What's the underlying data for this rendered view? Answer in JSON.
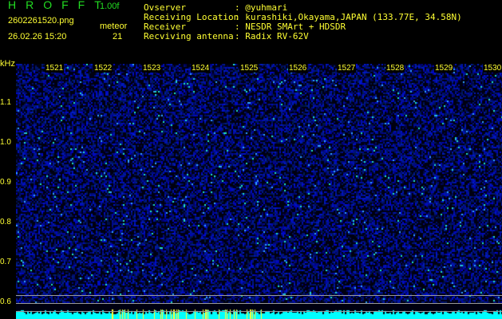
{
  "header": {
    "brand": "HROFFT",
    "version": "1.00f",
    "filename": "2602261520.png",
    "datetime": "26.02.26 15:20",
    "count_label": "meteor",
    "count": "21"
  },
  "info": [
    {
      "label": "Ovserver",
      "value": ": @yuhmari"
    },
    {
      "label": "Receiving Location",
      "value": ": kurashiki,Okayama,JAPAN (133.77E, 34.58N)"
    },
    {
      "label": "Receiver",
      "value": ": NESDR SMArt + HDSDR"
    },
    {
      "label": "Recviving antenna",
      "value": ": Radix RV-62V"
    }
  ],
  "axis": {
    "unit": "kHz",
    "x_ticks": [
      "1521",
      "1522",
      "1523",
      "1524",
      "1525",
      "1526",
      "1527",
      "1528",
      "1529",
      "1530"
    ],
    "y_ticks": [
      "1.1",
      "1.0",
      "0.9",
      "0.8",
      "0.7",
      "0.6"
    ]
  },
  "colors": {
    "text": "#ffff33",
    "brand": "#22dd22",
    "signal": "#00ffff"
  }
}
